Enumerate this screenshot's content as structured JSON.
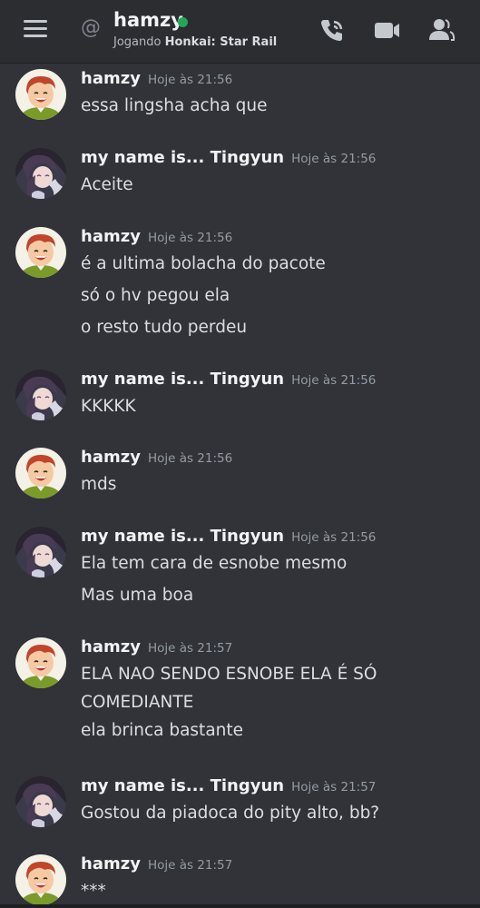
{
  "header": {
    "at_symbol": "@",
    "channel_name": "hamzy",
    "status_prefix": "Jogando ",
    "status_game": "Honkai: Star Rail",
    "icons": [
      "menu-icon",
      "at-icon",
      "online-dot",
      "call-icon",
      "video-icon",
      "members-icon"
    ],
    "online_color": "#23a55a"
  },
  "messages": [
    {
      "author": "hamzy",
      "time": "Hoje às 21:56",
      "avatar": "hamzy-avatar",
      "lines": [
        "essa lingsha acha que"
      ]
    },
    {
      "author": "my name is... Tingyun",
      "time": "Hoje às 21:56",
      "avatar": "tingyun-avatar",
      "lines": [
        "Aceite"
      ]
    },
    {
      "author": "hamzy",
      "time": "Hoje às 21:56",
      "avatar": "hamzy-avatar",
      "lines": [
        "é a ultima bolacha do pacote",
        "só o hv pegou ela",
        "o resto tudo perdeu"
      ]
    },
    {
      "author": "my name is... Tingyun",
      "time": "Hoje às 21:56",
      "avatar": "tingyun-avatar",
      "lines": [
        "KKKKK"
      ]
    },
    {
      "author": "hamzy",
      "time": "Hoje às 21:56",
      "avatar": "hamzy-avatar",
      "lines": [
        "mds"
      ]
    },
    {
      "author": "my name is... Tingyun",
      "time": "Hoje às 21:56",
      "avatar": "tingyun-avatar",
      "lines": [
        "Ela tem cara de esnobe mesmo",
        "Mas uma boa"
      ]
    },
    {
      "author": "hamzy",
      "time": "Hoje às 21:57",
      "avatar": "hamzy-avatar",
      "lines": [
        "ELA NAO SENDO ESNOBE ELA É SÓ",
        "COMEDIANTE",
        "ela brinca bastante"
      ]
    },
    {
      "author": "my name is... Tingyun",
      "time": "Hoje às 21:57",
      "avatar": "tingyun-avatar",
      "lines": [
        "Gostou da piadoca do pity alto, bb?"
      ]
    },
    {
      "author": "hamzy",
      "time": "Hoje às 21:57",
      "avatar": "hamzy-avatar",
      "lines": [
        "***"
      ]
    }
  ]
}
